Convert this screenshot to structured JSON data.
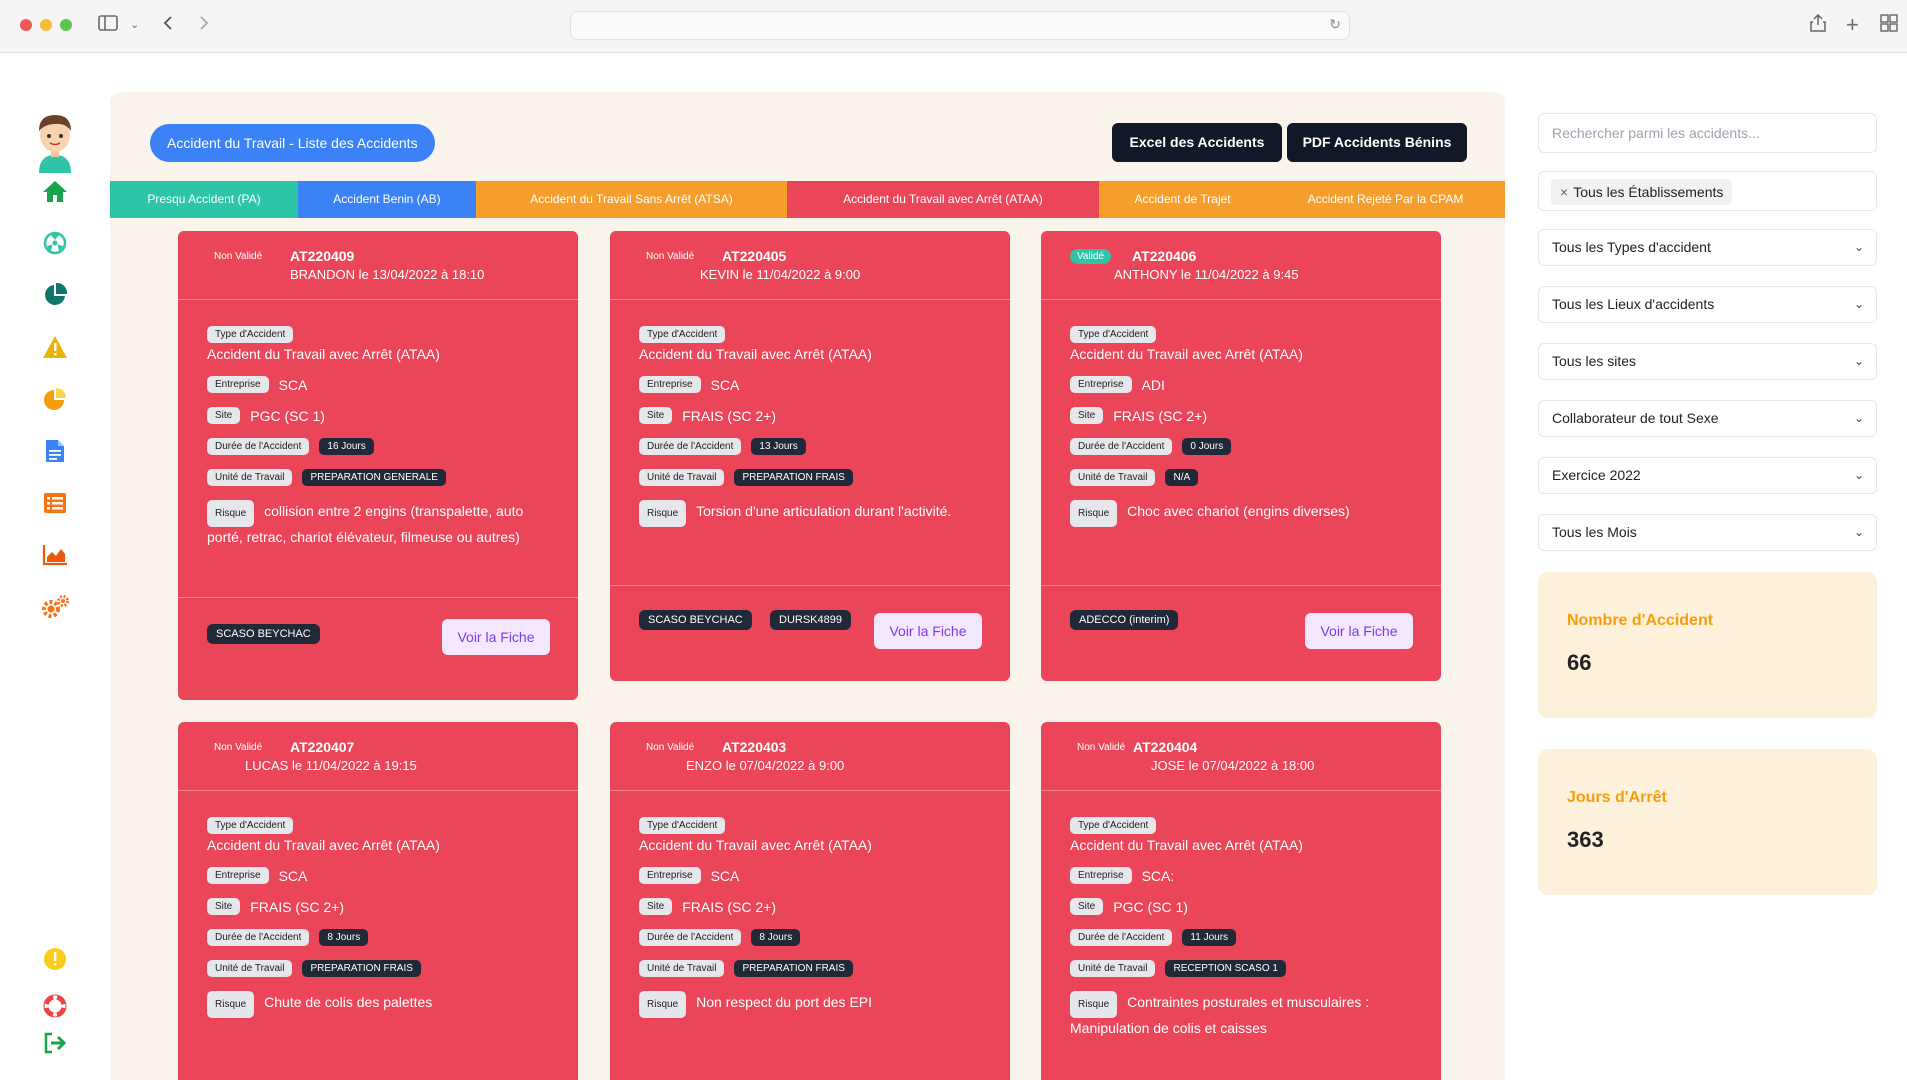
{
  "main": {
    "title_button": "Accident du Travail - Liste des Accidents",
    "excel_button": "Excel des Accidents",
    "pdf_button": "PDF Accidents Bénins",
    "tabs": [
      {
        "label": "Presqu Accident (PA)",
        "color": "#2ec4a7"
      },
      {
        "label": "Accident Benin (AB)",
        "color": "#3b82f6"
      },
      {
        "label": "Accident du Travail Sans Arrêt (ATSA)",
        "color": "#f59e2b"
      },
      {
        "label": "Accident du Travail avec Arrêt (ATAA)",
        "color": "#ea4558"
      },
      {
        "label": "Accident de Trajet",
        "color": "#f59e2b"
      },
      {
        "label": "Accident Rejeté Par la CPAM",
        "color": "#f59e2b"
      }
    ]
  },
  "labels": {
    "type": "Type d'Accident",
    "entreprise": "Entreprise",
    "site": "Site",
    "duree": "Durée de l'Accident",
    "unite": "Unité de Travail",
    "risque": "Risque",
    "voir_fiche": "Voir la Fiche"
  },
  "cards": [
    {
      "status": "Non Validé",
      "code": "AT220409",
      "who": "BRANDON le 13/04/2022 à 18:10",
      "type": "Accident du Travail avec Arrêt (ATAA)",
      "entreprise": "SCA",
      "site": "PGC (SC 1)",
      "duree": "16 Jours",
      "unite": "PREPARATION GENERALE",
      "risque": "collision entre 2 engins (transpalette, auto porté, retrac, chariot élévateur, filmeuse ou autres)",
      "tags": [
        "SCASO BEYCHAC"
      ]
    },
    {
      "status": "Non Validé",
      "code": "AT220405",
      "who": "KEVIN le 11/04/2022 à 9:00",
      "type": "Accident du Travail avec Arrêt (ATAA)",
      "entreprise": "SCA",
      "site": "FRAIS (SC 2+)",
      "duree": "13 Jours",
      "unite": "PREPARATION FRAIS",
      "risque": "Torsion d'une articulation durant l'activité.",
      "tags": [
        "SCASO BEYCHAC",
        "DURSK4899"
      ]
    },
    {
      "status": "Validé",
      "code": "AT220406",
      "who": "ANTHONY le 11/04/2022 à 9:45",
      "type": "Accident du Travail avec Arrêt (ATAA)",
      "entreprise": "ADI",
      "site": "FRAIS (SC 2+)",
      "duree": "0 Jours",
      "unite": "N/A",
      "risque": "Choc avec chariot (engins diverses)",
      "tags": [
        "ADECCO (interim)"
      ]
    },
    {
      "status": "Non Validé",
      "code": "AT220407",
      "who": "LUCAS le 11/04/2022 à 19:15",
      "type": "Accident du Travail avec Arrêt (ATAA)",
      "entreprise": "SCA",
      "site": "FRAIS (SC 2+)",
      "duree": "8 Jours",
      "unite": "PREPARATION FRAIS",
      "risque": "Chute de colis des palettes",
      "tags": []
    },
    {
      "status": "Non Validé",
      "code": "AT220403",
      "who": "ENZO le 07/04/2022 à 9:00",
      "type": "Accident du Travail avec Arrêt (ATAA)",
      "entreprise": "SCA",
      "site": "FRAIS (SC 2+)",
      "duree": "8 Jours",
      "unite": "PREPARATION FRAIS",
      "risque": "Non respect du port des EPI",
      "tags": []
    },
    {
      "status": "Non Validé",
      "code": "AT220404",
      "who": "JOSE le 07/04/2022 à 18:00",
      "type": "Accident du Travail avec Arrêt (ATAA)",
      "entreprise": "SCA:",
      "site": "PGC (SC 1)",
      "duree": "11 Jours",
      "unite": "RECEPTION SCASO 1",
      "risque": "Contraintes posturales et musculaires : Manipulation de colis et caisses",
      "tags": []
    }
  ],
  "filters": {
    "search_placeholder": "Rechercher parmi les accidents...",
    "etablissement_chip": "Tous les Établissements",
    "chip_remove": "×",
    "selects": [
      "Tous les Types d'accident",
      "Tous les Lieux d'accidents",
      "Tous les sites",
      "Collaborateur de tout Sexe",
      "Exercice 2022",
      "Tous les Mois"
    ]
  },
  "stats": {
    "accidents_label": "Nombre d'Accident",
    "accidents_value": "66",
    "arret_label": "Jours d'Arrêt",
    "arret_value": "363"
  },
  "icons": {
    "nav": [
      "home-icon",
      "radiation-icon",
      "pie-chart-icon",
      "warning-icon",
      "pie-chart-alt-icon",
      "document-icon",
      "list-icon",
      "area-chart-icon",
      "cogs-icon",
      "alert-circle-icon",
      "lifebuoy-icon",
      "logout-icon"
    ]
  }
}
